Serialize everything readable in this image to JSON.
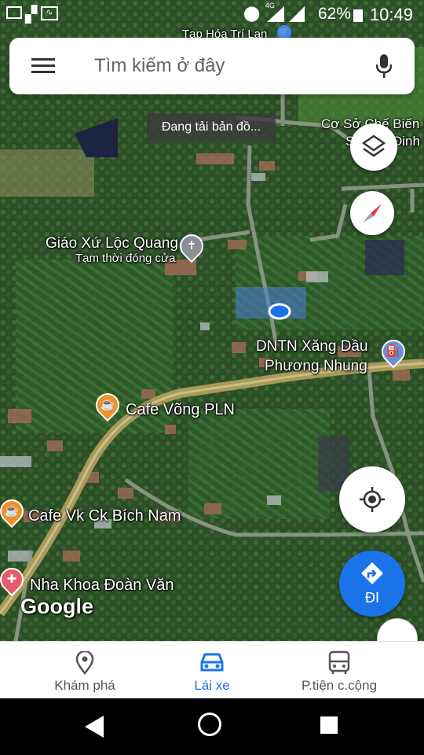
{
  "status_bar": {
    "time": "10:49",
    "battery": "62%",
    "network": "4G",
    "icons": [
      "gmail-icon",
      "flipboard-icon",
      "activity-icon",
      "location-icon",
      "signal-icon",
      "signal-x-icon",
      "battery-icon"
    ]
  },
  "search": {
    "placeholder": "Tìm kiếm ở đây",
    "menu_icon": "hamburger-menu-icon",
    "mic_icon": "microphone-icon"
  },
  "map": {
    "loading_text": "Đang tải bản đồ...",
    "attribution": "Google",
    "places": [
      {
        "name": "Tạp Hóa Trí Lan",
        "icon": "shopping-cart-icon"
      },
      {
        "name": "Cơ Sở Chế Biến N",
        "line2": "S",
        "line3": "Đinh"
      },
      {
        "name": "Giáo Xứ Lộc Quang",
        "note": "Tạm thời đóng cửa",
        "icon": "church-cross-icon"
      },
      {
        "name": "DNTN Xăng Dầu",
        "line2": "Phương Nhung",
        "icon": "gas-station-icon"
      },
      {
        "name": "Cafe Võng PLN",
        "icon": "coffee-cup-icon"
      },
      {
        "name": "Cafe Vk Ck Bích Nam",
        "icon": "coffee-cup-icon"
      },
      {
        "name": "Nha Khoa Đoàn Văn",
        "icon": "medical-cross-icon"
      }
    ],
    "colors": {
      "road": "#a89a5a",
      "location_dot": "#1a73e8",
      "accent_blue": "#1a73e8"
    }
  },
  "controls": {
    "layers_icon": "layers-icon",
    "compass_icon": "compass-icon",
    "my_location_icon": "my-location-crosshair-icon",
    "go_label": "ĐI",
    "go_icon": "turn-right-arrow-icon"
  },
  "bottom_nav": {
    "tabs": [
      {
        "label": "Khám phá",
        "icon": "explore-pin-icon",
        "active": false
      },
      {
        "label": "Lái xe",
        "icon": "car-icon",
        "active": true
      },
      {
        "label": "P.tiện c.cộng",
        "icon": "bus-icon",
        "active": false
      }
    ]
  },
  "system_nav": {
    "back_icon": "back-triangle-icon",
    "home_icon": "home-circle-icon",
    "recents_icon": "recents-square-icon"
  }
}
